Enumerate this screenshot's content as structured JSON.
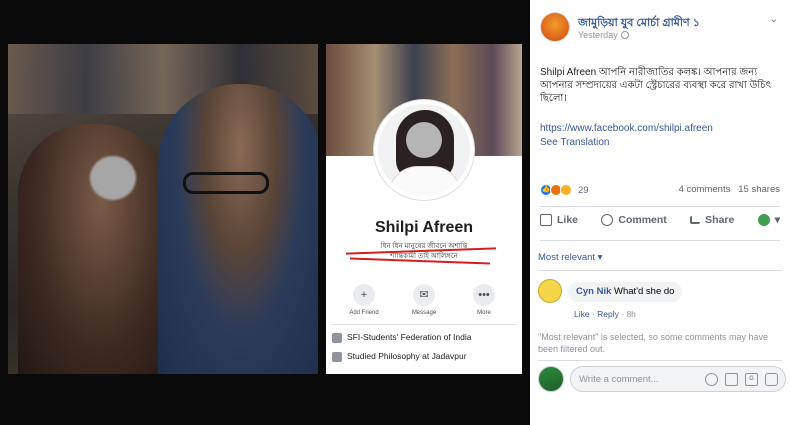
{
  "profile": {
    "name": "Shilpi Afreen",
    "bio_line1": "ধিন ধিন মানুষের জীবনে অশান্তি",
    "bio_line2": "শান্তিকামী তাই আলিঙ্গনে",
    "actions": [
      {
        "label": "Add Friend",
        "icon": "add-friend-icon",
        "glyph": "+"
      },
      {
        "label": "Message",
        "icon": "messenger-icon",
        "glyph": "✉"
      },
      {
        "label": "More",
        "icon": "more-icon",
        "glyph": "•••"
      }
    ],
    "info": [
      {
        "text": "SFI-Students' Federation of India",
        "icon": "briefcase-icon"
      },
      {
        "text": "Studied Philosophy at Jadavpur",
        "icon": "graduation-icon"
      }
    ]
  },
  "post": {
    "author": "জামুড়িয়া যুব মোর্চা গ্রামীণ ১",
    "time": "Yesterday",
    "text": "Shilpi Afreen আপনি নারীজাতির কলঙ্ক। আপনার জন্য আপনার সম্প্রদায়ের একটা স্ট্রেচারের ব্যবস্থা করে রাখা উচিৎ ছিলো।",
    "link": "https://www.facebook.com/shilpi.afreen",
    "see_translation": "See Translation",
    "reactions_count": "29",
    "comments_count": "4 comments",
    "shares_count": "15 shares",
    "buttons": {
      "like": "Like",
      "comment": "Comment",
      "share": "Share"
    },
    "sort_label": "Most relevant ▾",
    "comment": {
      "author": "Cyn Nik",
      "text": "What'd she do",
      "like": "Like",
      "reply": "Reply",
      "age": "8h"
    },
    "notice": "\"Most relevant\" is selected, so some comments may have been filtered out.",
    "comment_placeholder": "Write a comment..."
  },
  "colors": {
    "link_blue": "#385898",
    "name_blue": "#365899",
    "muted": "#90949c",
    "strike_red": "#d21f1f"
  }
}
